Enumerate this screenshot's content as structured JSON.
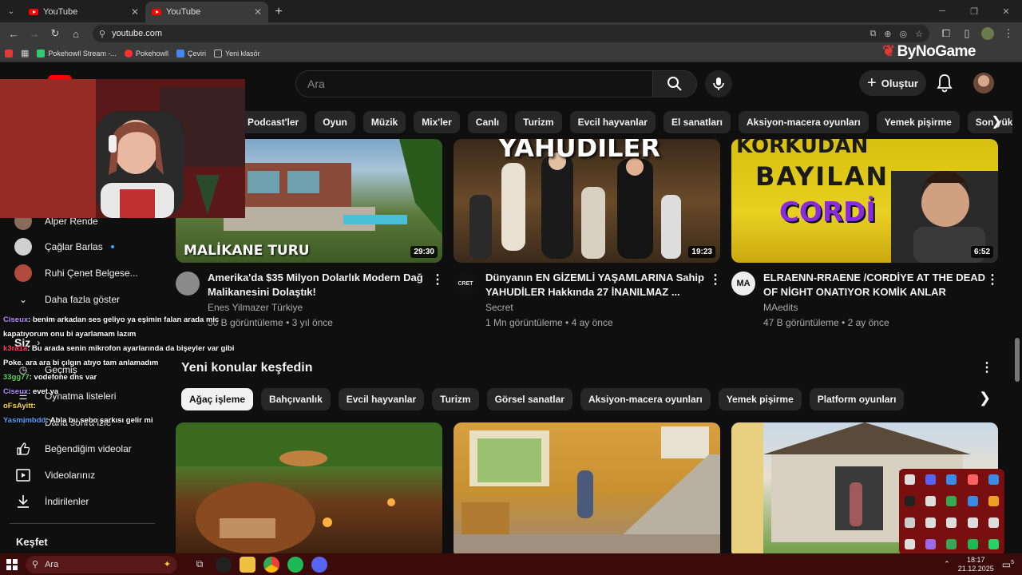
{
  "browser": {
    "tabs": [
      {
        "title": "YouTube",
        "active": false
      },
      {
        "title": "YouTube",
        "active": true
      }
    ],
    "url": "youtube.com",
    "bookmarks": [
      {
        "label": "Pokehowll Stream -...",
        "color": "#2ecc71"
      },
      {
        "label": "Pokehowll",
        "color": "#ff3030"
      },
      {
        "label": "Çeviri",
        "color": "#4285f4"
      },
      {
        "label": "Yeni klasör",
        "color": "#bbbbbb"
      }
    ],
    "overlay_brand": "ByNoGame"
  },
  "masthead": {
    "logo_region": "TR",
    "search_placeholder": "Ara",
    "create_label": "Oluştur"
  },
  "chips": [
    "Podcast'ler",
    "Oyun",
    "Müzik",
    "Mix'ler",
    "Canlı",
    "Turizm",
    "Evcil hayvanlar",
    "El sanatları",
    "Aksiyon-macera oyunları",
    "Yemek pişirme",
    "Son yüklenenler"
  ],
  "sidebar": {
    "subscriptions": [
      {
        "name": "Alper Rende",
        "color": "#8a6a5a"
      },
      {
        "name": "Çağlar Barlas",
        "color": "#d0d0d0",
        "new": true
      },
      {
        "name": "Ruhi Çenet Belgese...",
        "color": "#b04a3a"
      }
    ],
    "show_more": "Daha fazla göster",
    "you_heading": "Siz",
    "you_items": [
      "Geçmiş",
      "Oynatma listeleri",
      "Daha sonra izle",
      "Beğendiğim videolar",
      "Videolarınız",
      "İndirilenler"
    ],
    "explore_heading": "Keşfet"
  },
  "videos": [
    {
      "title_line1": "Amerika'da $35 Milyon Dolarlık Modern Dağ",
      "title_line2": "Malikanesini Dolaştık!",
      "channel": "Enes Yilmazer Türkiye",
      "meta": "30 B görüntüleme • 3 yıl önce",
      "duration": "29:30",
      "thumb_text": "MALİKANE TURU"
    },
    {
      "title_line1": "Dünyanın EN GİZEMLİ YAŞAMLARINA Sahip",
      "title_line2": "YAHUDİLER Hakkında 27 İNANILMAZ ...",
      "channel": "Secret",
      "meta": "1 Mn görüntüleme • 4 ay önce",
      "duration": "19:23",
      "thumb_text": "YAHUDİLER",
      "avatar_text": "CRET"
    },
    {
      "title_line1": "ELRAENN-RRAENE /CORDİYE AT THE DEAD",
      "title_line2": "OF NİGHT ONATIYOR KOMİK ANLAR",
      "channel": "MAedits",
      "meta": "47 B görüntüleme • 2 ay önce",
      "duration": "6:52",
      "thumb_text_1": "KORKUDAN",
      "thumb_text_2": "BAYILAN",
      "thumb_text_3": "CORDİ",
      "avatar_text": "MA"
    }
  ],
  "topics": {
    "title": "Yeni konular keşfedin",
    "chips": [
      "Ağaç işleme",
      "Bahçıvanlık",
      "Evcil hayvanlar",
      "Turizm",
      "Görsel sanatlar",
      "Aksiyon-macera oyunları",
      "Yemek pişirme",
      "Platform oyunları"
    ],
    "selected": 0
  },
  "chat": [
    {
      "user": "Ciseux",
      "user_color": "#b48cff",
      "msg": ": benim arkadan ses geliyo ya eşimin falan arada mic"
    },
    {
      "user": "",
      "user_color": "#ffffff",
      "msg": "kapatıyorum onu bi ayarlamam lazım"
    },
    {
      "user": "k3ra1a",
      "user_color": "#ff4060",
      "msg": ": Bu arada senin mikrofon ayarlarında da bişeyler var gibi"
    },
    {
      "user": "",
      "user_color": "#ffffff",
      "msg": "Poke. ara ara bi çılgın atıyo tam anlamadım"
    },
    {
      "user": "33gg77",
      "user_color": "#5cd65c",
      "msg": ": vodefone dns var"
    },
    {
      "user": "Ciseux",
      "user_color": "#b48cff",
      "msg": ": evet ya"
    },
    {
      "user": "oFsAyitt",
      "user_color": "#ffd34d",
      "msg": ": "
    },
    {
      "user": "Yasmimbdd",
      "user_color": "#5aa0ff",
      "msg": ": Abla bu sebo şarkısı gelir mi"
    }
  ],
  "taskbar": {
    "search_placeholder": "Ara",
    "time": "18:17",
    "date": "21.12.2025",
    "notif_count": "5"
  },
  "colors": {
    "accent_red": "#ff0000",
    "taskbar": "#3b0a0a",
    "tray_popup": "#7a0f0f"
  }
}
